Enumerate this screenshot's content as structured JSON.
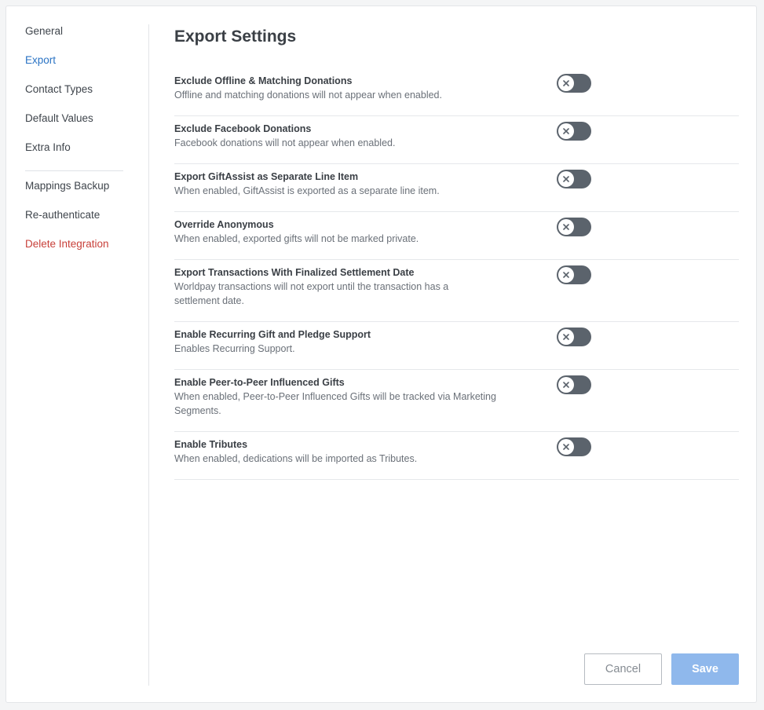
{
  "sidebar": {
    "items": [
      {
        "label": "General"
      },
      {
        "label": "Export"
      },
      {
        "label": "Contact Types"
      },
      {
        "label": "Default Values"
      },
      {
        "label": "Extra Info"
      },
      {
        "label": "Mappings Backup"
      },
      {
        "label": "Re-authenticate"
      },
      {
        "label": "Delete Integration"
      }
    ],
    "active_item": "Export"
  },
  "main": {
    "title": "Export Settings",
    "settings": [
      {
        "title": "Exclude Offline & Matching Donations",
        "description": "Offline and matching donations will not appear when enabled.",
        "enabled": false
      },
      {
        "title": "Exclude Facebook Donations",
        "description": "Facebook donations will not appear when enabled.",
        "enabled": false
      },
      {
        "title": "Export GiftAssist as Separate Line Item",
        "description": "When enabled, GiftAssist is exported as a separate line item.",
        "enabled": false
      },
      {
        "title": "Override Anonymous",
        "description": "When enabled, exported gifts will not be marked private.",
        "enabled": false
      },
      {
        "title": "Export Transactions With Finalized Settlement Date",
        "description": "Worldpay transactions will not export until the transaction has a settlement date.",
        "enabled": false
      },
      {
        "title": "Enable Recurring Gift and Pledge Support",
        "description": "Enables Recurring Support.",
        "enabled": false
      },
      {
        "title": "Enable Peer-to-Peer Influenced Gifts",
        "description": "When enabled, Peer-to-Peer Influenced Gifts will be tracked via Marketing Segments.",
        "enabled": false
      },
      {
        "title": "Enable Tributes",
        "description": "When enabled, dedications will be imported as Tributes.",
        "enabled": false
      }
    ]
  },
  "footer": {
    "cancel_label": "Cancel",
    "save_label": "Save"
  },
  "colors": {
    "accent": "#2a73c4",
    "danger": "#c8403a",
    "toggle_off": "#5b636c",
    "save_button": "#8fb8ec"
  },
  "icons": {
    "toggle_knob": "x-icon"
  }
}
